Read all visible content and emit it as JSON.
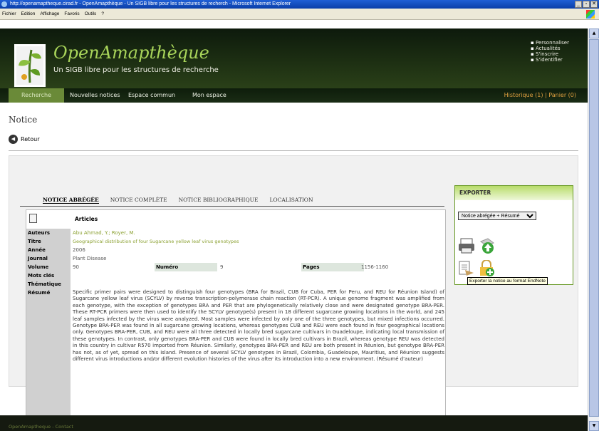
{
  "window": {
    "title": "http://openamaptheque.cirad.fr - OpenAmapthèque - Un SIGB libre pour les structures de recherch - Microsoft Internet Explorer",
    "buttons": [
      "_",
      "▫",
      "✕"
    ]
  },
  "menubar": {
    "items": [
      "Fichier",
      "Edition",
      "Affichage",
      "Favoris",
      "Outils",
      "?"
    ]
  },
  "site": {
    "name": "OpenAmapthèque",
    "tagline": "Un SIGB libre pour les structures de recherche",
    "user_links": [
      "Personnaliser",
      "Actualités",
      "S'inscrire",
      "S'identifier"
    ]
  },
  "nav": {
    "items": [
      "Recherche",
      "Nouvelles notices",
      "Espace commun",
      "Mon espace"
    ],
    "right": "Historique (1) | Panier (0)"
  },
  "page_title": "Notice",
  "back_label": "Retour",
  "tabs": [
    "NOTICE ABRÉGÉE",
    "NOTICE COMPLÈTE",
    "NOTICE BIBLIOGRAPHIQUE",
    "LOCALISATION"
  ],
  "notice": {
    "doc_type": "Articles",
    "labels": {
      "auteurs": "Auteurs",
      "titre": "Titre",
      "annee": "Année",
      "journal": "Journal",
      "volume": "Volume",
      "numero": "Numéro",
      "pages": "Pages",
      "mots_cles": "Mots clés",
      "thematique": "Thématique",
      "resume": "Résumé"
    },
    "auteurs": "Abu Ahmad, Y.; Royer, M.",
    "titre": "Geographical distribution of four Sugarcane yellow leaf virus genotypes",
    "annee": "2006",
    "journal": "Plant Disease",
    "volume": "90",
    "numero": "9",
    "pages": "1156-1160",
    "resume": "Specific primer pairs were designed to distinguish four genotypes (BRA for Brazil, CUB for Cuba, PER for Peru, and REU for Réunion Island) of Sugarcane yellow leaf virus (SCYLV) by reverse transcription-polymerase chain reaction (RT-PCR). A unique genome fragment was amplified from each genotype, with the exception of genotypes BRA and PER that are phylogenetically relatively close and were designated genotype BRA-PER. These RT-PCR primers were then used to identify the SCYLV genotype(s) present in 18 different sugarcane growing locations in the world, and 245 leaf samples infected by the virus were analyzed. Most samples were infected by only one of the three genotypes, but mixed infections occurred. Genotype BRA-PER was found in all sugarcane growing locations, whereas genotypes CUB and REU were each found in four geographical locations only. Genotypes BRA-PER, CUB, and REU were all three detected in locally bred sugarcane cultivars in Guadeloupe, indicating local transmission of these genotypes. In contrast, only genotypes BRA-PER and CUB were found in locally bred cultivars in Brazil, whereas genotype REU was detected in this country in cultivar R570 imported from Réunion. Similarly, genotypes BRA-PER and REU are both present in Réunion, but genotype BRA-PER has not, as of yet, spread on this island. Presence of several SCYLV genotypes in Brazil, Colombia, Guadeloupe, Mauritius, and Réunion suggests different virus introductions and/or different evolution histories of the virus after its introduction into a new environment. (Résumé d'auteur)"
  },
  "export": {
    "title": "EXPORTER",
    "select_value": "Notice abrégée + Résumé",
    "tooltip": "Exporter la notice au format EndNote"
  },
  "footer": {
    "text": "OpenAmaptheque - Contact"
  }
}
